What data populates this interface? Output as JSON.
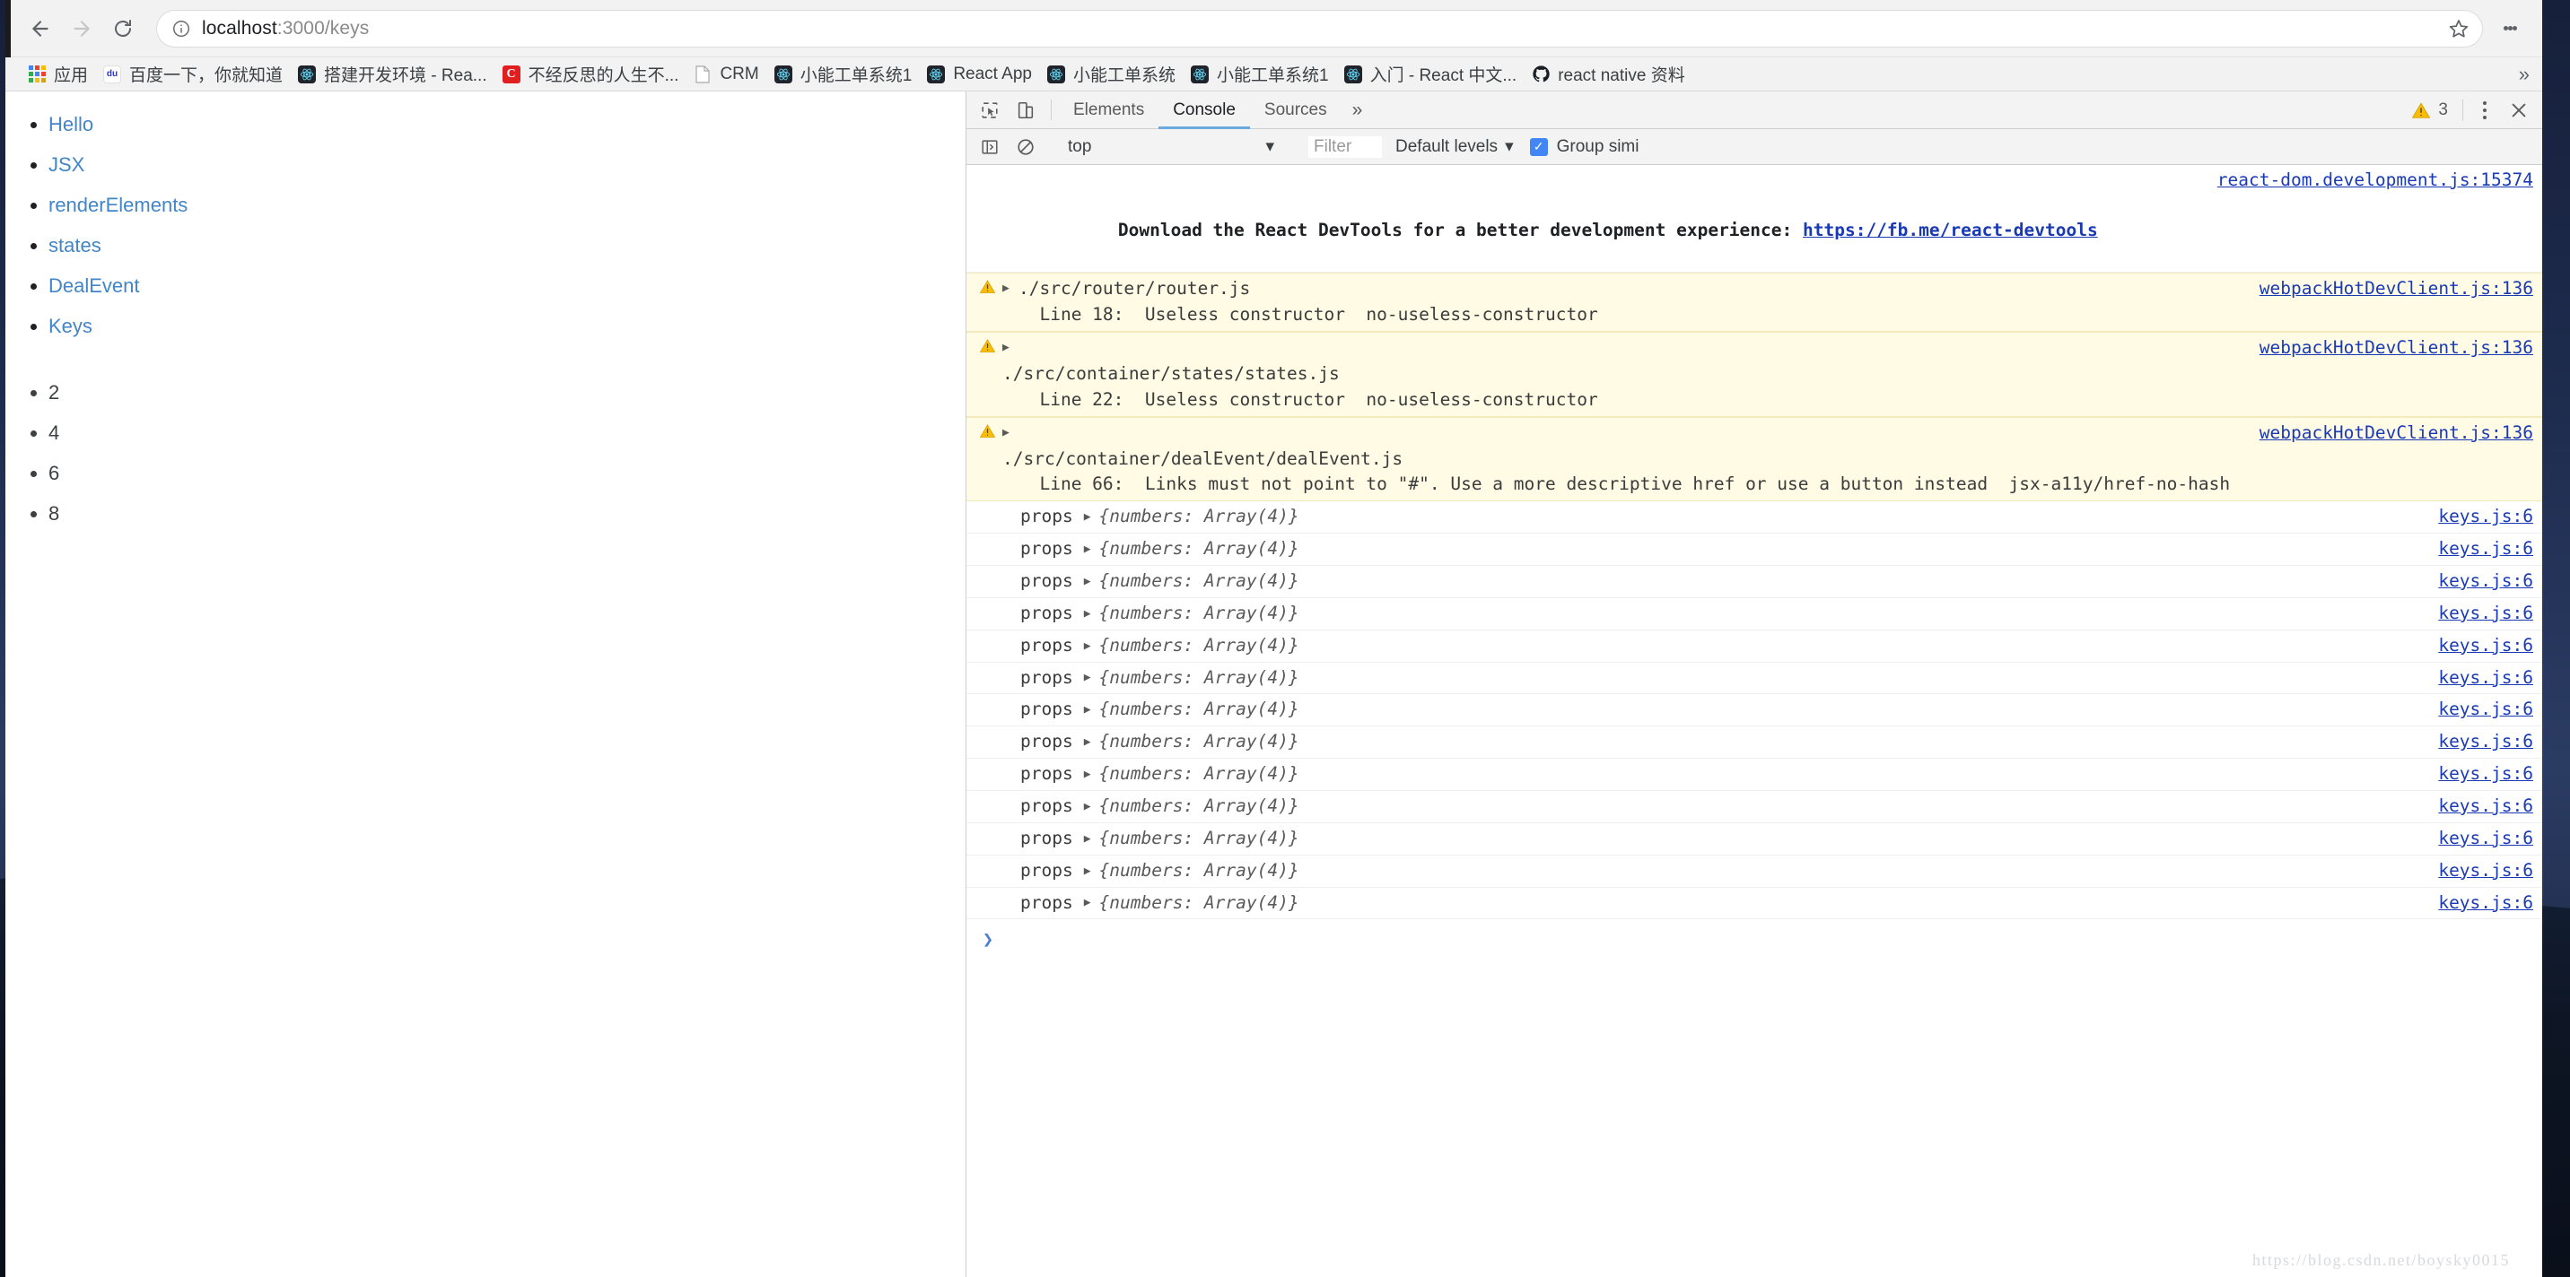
{
  "browser": {
    "back_label": "Back",
    "forward_label": "Forward",
    "reload_label": "Reload",
    "omnibox": {
      "host": "localhost",
      "path": ":3000/keys",
      "full": "localhost:3000/keys",
      "info_icon": "info-circle-icon",
      "bookmark_icon": "star-outline-icon"
    },
    "menu_icon": "kebab-menu-icon",
    "bookmarks": [
      {
        "label": "应用",
        "icon": "apps-grid-icon"
      },
      {
        "label": "百度一下，你就知道",
        "icon": "baidu-favicon"
      },
      {
        "label": "搭建开发环境 - Rea...",
        "icon": "react-favicon"
      },
      {
        "label": "不经反思的人生不...",
        "icon": "csdn-favicon"
      },
      {
        "label": "CRM",
        "icon": "document-favicon"
      },
      {
        "label": "小能工单系统1",
        "icon": "react-favicon"
      },
      {
        "label": "React App",
        "icon": "react-favicon"
      },
      {
        "label": "小能工单系统",
        "icon": "react-favicon"
      },
      {
        "label": "小能工单系统1",
        "icon": "react-favicon"
      },
      {
        "label": "入门 - React 中文...",
        "icon": "react-favicon"
      },
      {
        "label": "react native 资料",
        "icon": "github-favicon"
      }
    ],
    "bookmarks_overflow_icon": "chevron-double-right-icon"
  },
  "page": {
    "nav_links": [
      {
        "label": "Hello"
      },
      {
        "label": "JSX"
      },
      {
        "label": "renderElements"
      },
      {
        "label": "states"
      },
      {
        "label": "DealEvent"
      },
      {
        "label": "Keys"
      }
    ],
    "numbers": [
      "2",
      "4",
      "6",
      "8"
    ]
  },
  "devtools": {
    "inspect_icon": "inspect-element-icon",
    "device_toolbar_icon": "device-toolbar-icon",
    "tabs": [
      {
        "label": "Elements",
        "active": false
      },
      {
        "label": "Console",
        "active": true
      },
      {
        "label": "Sources",
        "active": false
      }
    ],
    "more_tabs_icon": "chevron-double-right-icon",
    "warning_icon": "warning-triangle-icon",
    "warning_count": "3",
    "settings_icon": "kebab-menu-icon",
    "close_icon": "close-icon",
    "console_bar": {
      "sidebar_toggle_icon": "console-sidebar-icon",
      "clear_icon": "clear-console-icon",
      "context": "top",
      "context_caret_icon": "chevron-down-icon",
      "filter_placeholder": "Filter",
      "levels_label": "Default levels",
      "levels_caret_icon": "chevron-down-icon",
      "group_similar_label": "Group simi",
      "group_similar_checked": true,
      "checkbox_icon": "check-icon"
    },
    "messages": [
      {
        "type": "info",
        "source": "react-dom.development.js:15374",
        "text_before": "Download the React DevTools for a better development experience: ",
        "link": "https://fb.me/react-devtools"
      },
      {
        "type": "warning",
        "icon": "warning-triangle-icon",
        "arrow_icon": "triangle-right-icon",
        "source": "webpackHotDevClient.js:136",
        "file": "./src/router/router.js",
        "detail": "  Line 18:  Useless constructor  no-useless-constructor",
        "source_position": "inline"
      },
      {
        "type": "warning",
        "icon": "warning-triangle-icon",
        "arrow_icon": "triangle-right-icon",
        "source": "webpackHotDevClient.js:136",
        "file": "./src/container/states/states.js",
        "detail": "  Line 22:  Useless constructor  no-useless-constructor",
        "source_position": "own-line"
      },
      {
        "type": "warning",
        "icon": "warning-triangle-icon",
        "arrow_icon": "triangle-right-icon",
        "source": "webpackHotDevClient.js:136",
        "file": "./src/container/dealEvent/dealEvent.js",
        "detail": "  Line 66:  Links must not point to \"#\". Use a more descriptive href or use a button instead  jsx-a11y/href-no-hash",
        "source_position": "own-line"
      }
    ],
    "log_rows": [
      {
        "label": "props",
        "arrow_icon": "triangle-right-icon",
        "value": "{numbers: Array(4)}",
        "source": "keys.js:6"
      },
      {
        "label": "props",
        "arrow_icon": "triangle-right-icon",
        "value": "{numbers: Array(4)}",
        "source": "keys.js:6"
      },
      {
        "label": "props",
        "arrow_icon": "triangle-right-icon",
        "value": "{numbers: Array(4)}",
        "source": "keys.js:6"
      },
      {
        "label": "props",
        "arrow_icon": "triangle-right-icon",
        "value": "{numbers: Array(4)}",
        "source": "keys.js:6"
      },
      {
        "label": "props",
        "arrow_icon": "triangle-right-icon",
        "value": "{numbers: Array(4)}",
        "source": "keys.js:6"
      },
      {
        "label": "props",
        "arrow_icon": "triangle-right-icon",
        "value": "{numbers: Array(4)}",
        "source": "keys.js:6"
      },
      {
        "label": "props",
        "arrow_icon": "triangle-right-icon",
        "value": "{numbers: Array(4)}",
        "source": "keys.js:6"
      },
      {
        "label": "props",
        "arrow_icon": "triangle-right-icon",
        "value": "{numbers: Array(4)}",
        "source": "keys.js:6"
      },
      {
        "label": "props",
        "arrow_icon": "triangle-right-icon",
        "value": "{numbers: Array(4)}",
        "source": "keys.js:6"
      },
      {
        "label": "props",
        "arrow_icon": "triangle-right-icon",
        "value": "{numbers: Array(4)}",
        "source": "keys.js:6"
      },
      {
        "label": "props",
        "arrow_icon": "triangle-right-icon",
        "value": "{numbers: Array(4)}",
        "source": "keys.js:6"
      },
      {
        "label": "props",
        "arrow_icon": "triangle-right-icon",
        "value": "{numbers: Array(4)}",
        "source": "keys.js:6"
      },
      {
        "label": "props",
        "arrow_icon": "triangle-right-icon",
        "value": "{numbers: Array(4)}",
        "source": "keys.js:6"
      }
    ],
    "prompt_symbol": "❯"
  },
  "watermark": "https://blog.csdn.net/boysky0015",
  "colors": {
    "accent": "#4285f4",
    "link": "#4285c8",
    "warning_bg": "#fffbe5",
    "devtools_tab_underline": "#6aa9e0",
    "console_link": "#1a3ab5"
  }
}
